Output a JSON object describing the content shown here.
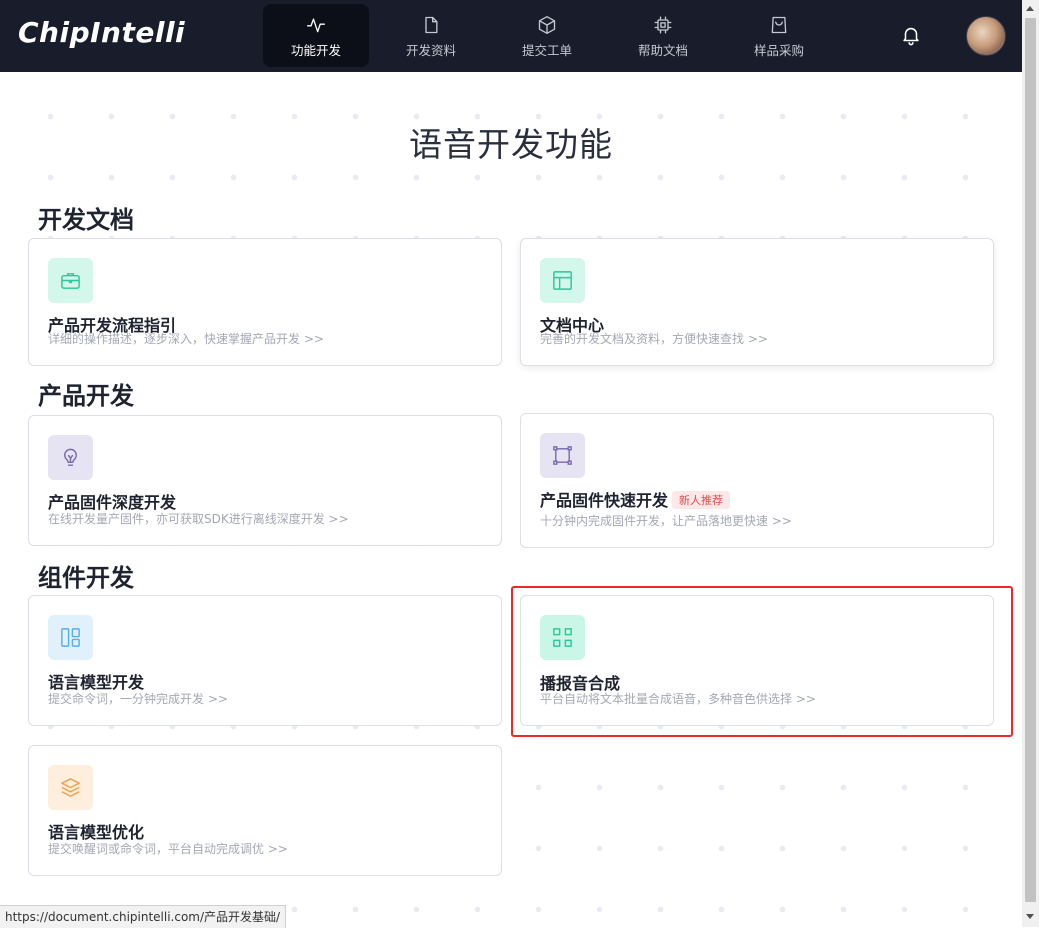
{
  "header": {
    "logo": "ChipIntelli",
    "nav": [
      {
        "label": "功能开发",
        "icon": "activity-icon",
        "active": true
      },
      {
        "label": "开发资料",
        "icon": "file-icon",
        "active": false
      },
      {
        "label": "提交工单",
        "icon": "box-icon",
        "active": false
      },
      {
        "label": "帮助文档",
        "icon": "chip-icon",
        "active": false
      },
      {
        "label": "样品采购",
        "icon": "shopping-bag-icon",
        "active": false
      }
    ],
    "bell_icon": "bell-icon",
    "avatar_icon": "avatar"
  },
  "main": {
    "title": "语音开发功能",
    "sections": [
      {
        "title": "开发文档",
        "cards": [
          {
            "title": "产品开发流程指引",
            "desc": "详细的操作描述，逐步深入，快速掌握产品开发 >>",
            "icon": "briefcase-icon",
            "icon_bg": "#d4f7ec",
            "icon_color": "#2cc79a"
          },
          {
            "title": "文档中心",
            "desc": "完善的开发文档及资料，方便快速查找 >>",
            "icon": "layout-icon",
            "icon_bg": "#d4f7ec",
            "icon_color": "#2cc79a"
          }
        ]
      },
      {
        "title": "产品开发",
        "cards": [
          {
            "title": "产品固件深度开发",
            "desc": "在线开发量产固件，亦可获取SDK进行离线深度开发 >>",
            "icon": "lightbulb-icon",
            "icon_bg": "#e6e3f3",
            "icon_color": "#7b6bb0"
          },
          {
            "title": "产品固件快速开发",
            "tag": "新人推荐",
            "desc": "十分钟内完成固件开发，让产品落地更快速 >>",
            "icon": "frame-icon",
            "icon_bg": "#e6e3f3",
            "icon_color": "#7b6bb0"
          }
        ]
      },
      {
        "title": "组件开发",
        "cards": [
          {
            "title": "语言模型开发",
            "desc": "提交命令词，一分钟完成开发 >>",
            "icon": "columns-icon",
            "icon_bg": "#e1f1fc",
            "icon_color": "#5aaee6"
          },
          {
            "title": "播报音合成",
            "desc": "平台自动将文本批量合成语音，多种音色供选择 >>",
            "icon": "grid-icon",
            "icon_bg": "#c9f6e6",
            "icon_color": "#2cc79a"
          },
          {
            "title": "语言模型优化",
            "desc": "提交唤醒词或命令词，平台自动完成调优 >>",
            "icon": "layers-icon",
            "icon_bg": "#fdeedd",
            "icon_color": "#f0a24c"
          }
        ]
      }
    ]
  },
  "status_bar": {
    "url": "https://document.chipintelli.com/产品开发基础/"
  },
  "colors": {
    "header_bg": "#181c2b",
    "highlight": "#e82a2a",
    "tag_text": "#e24b4b"
  }
}
